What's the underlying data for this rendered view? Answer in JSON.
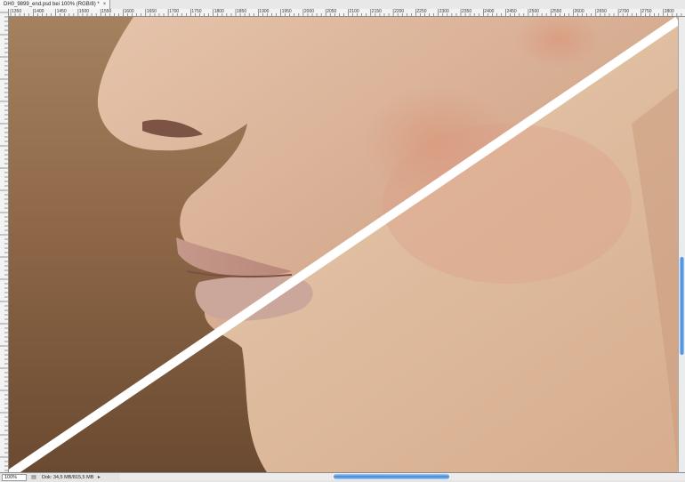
{
  "document_tab": {
    "title": "DH0_9899_end.psd bei 100% (RGB/8) *",
    "close_symbol": "×"
  },
  "ruler": {
    "ticks": [
      "1350",
      "1400",
      "1450",
      "1500",
      "1550",
      "1600",
      "1650",
      "1700",
      "1750",
      "1800",
      "1850",
      "1900",
      "1950",
      "2000",
      "2050",
      "2100",
      "2150",
      "2200",
      "2250",
      "2300",
      "2350",
      "2400",
      "2450",
      "2500",
      "2550",
      "2600",
      "2650",
      "2700",
      "2750",
      "2800"
    ]
  },
  "canvas": {
    "description_icon": "before-after-photo"
  },
  "status_bar": {
    "zoom": "100%",
    "doc_info": "Dok: 34,5 MB/815,5 MB",
    "icon": "document-info-icon",
    "arrow": "▸"
  },
  "scrollbars": {
    "accent": "#3d87d9"
  }
}
